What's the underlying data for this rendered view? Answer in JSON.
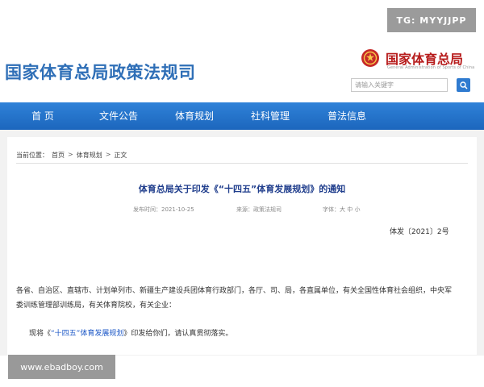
{
  "site": {
    "title": "国家体育总局政策法规司",
    "org_cn": "国家体育总局",
    "org_en": "General Administration of Sports of China"
  },
  "search": {
    "placeholder": "请输入关键字"
  },
  "nav": {
    "items": [
      {
        "label": "首  页"
      },
      {
        "label": "文件公告"
      },
      {
        "label": "体育规划"
      },
      {
        "label": "社科管理"
      },
      {
        "label": "普法信息"
      }
    ]
  },
  "breadcrumb": {
    "prefix": "当前位置：",
    "items": [
      "首页",
      "体育规划",
      "正文"
    ],
    "separator": ">"
  },
  "article": {
    "title": "体育总局关于印发《“十四五”体育发展规划》的通知",
    "publish_date": "发布时间：2021-10-25",
    "source": "来源：政策法规司",
    "font_size": "字体：大 中 小",
    "doc_number": "体发〔2021〕2号",
    "recipients": "各省、自治区、直辖市、计划单列市、新疆生产建设兵团体育行政部门，各厅、司、局，各直属单位，有关全国性体育社会组织，中央军委训练管理部训练局，有关体育院校，有关企业：",
    "body_prefix": "现将《",
    "body_link": "“十四五”体育发展规划",
    "body_suffix": "》印发给你们，请认真贯彻落实。"
  },
  "watermarks": {
    "top": "TG: MYYJJPP",
    "bottom": "www.ebadboy.com"
  },
  "colors": {
    "brand_blue": "#2f6fb7",
    "nav_blue": "#2a7ad2",
    "emblem_red": "#c62828"
  }
}
